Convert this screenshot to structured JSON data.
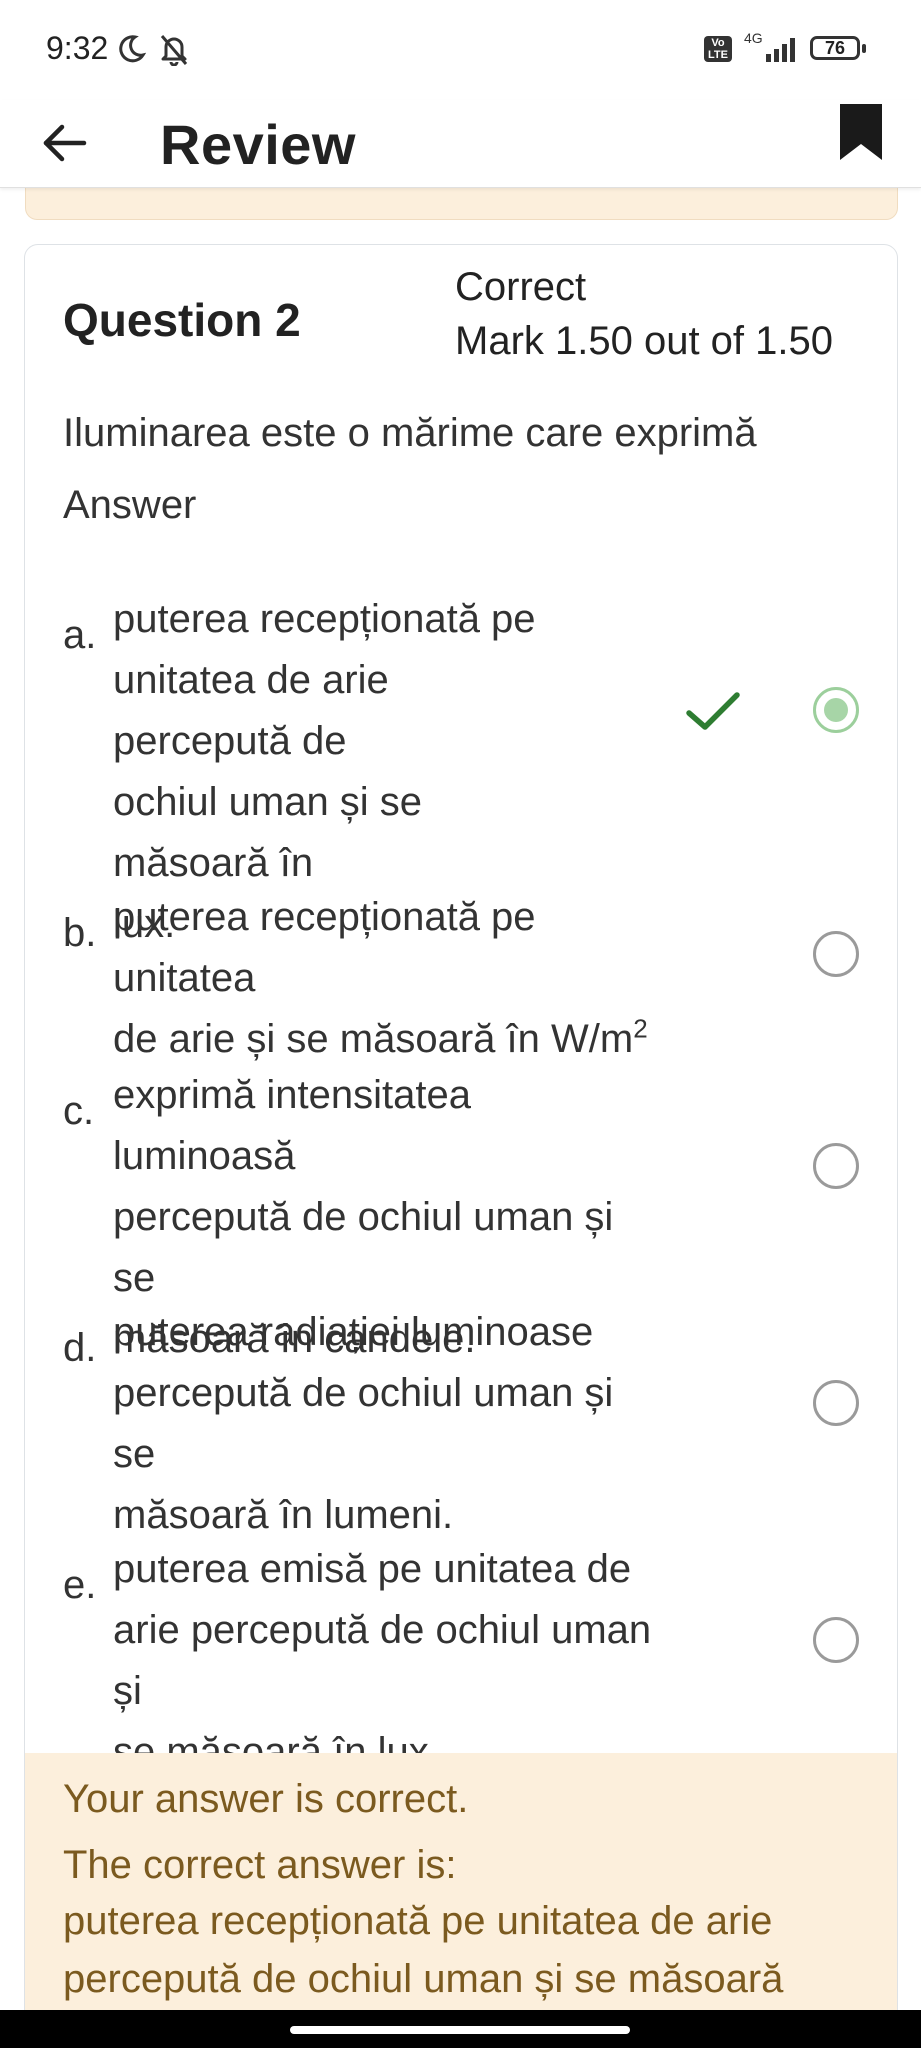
{
  "status_bar": {
    "time": "9:32",
    "volte_label": "Vo LTE",
    "network": "4G",
    "battery": "76"
  },
  "app_bar": {
    "title": "Review",
    "back_icon": "arrow-left-icon",
    "bookmark_icon": "bookmark-icon"
  },
  "question": {
    "number": "Question 2",
    "state": "Correct",
    "mark": "Mark 1.50 out of 1.50",
    "text": "Iluminarea este o mărime care exprimă",
    "answer_label": "Answer",
    "options": [
      {
        "letter": "a.",
        "lines": [
          "puterea recepționată pe",
          "unitatea de arie percepută de",
          "ochiul uman și se măsoară în",
          "lux."
        ],
        "selected": true,
        "correct": true
      },
      {
        "letter": "b.",
        "lines": [
          "puterea recepționată pe unitatea",
          "de arie și se măsoară în W/m",
          "2"
        ],
        "selected": false
      },
      {
        "letter": "c.",
        "lines": [
          "exprimă intensitatea luminoasă",
          "percepută de ochiul uman și se",
          "măsoară în candele."
        ],
        "selected": false
      },
      {
        "letter": "d.",
        "lines": [
          "puterea radiației luminoase",
          "percepută de ochiul uman și se",
          "măsoară în lumeni."
        ],
        "selected": false
      },
      {
        "letter": "e.",
        "lines": [
          "puterea emisă pe unitatea de",
          "arie percepută de ochiul uman și",
          "se măsoară în lux."
        ],
        "selected": false
      }
    ]
  },
  "feedback": {
    "result": "Your answer is correct.",
    "correct_intro": "The correct answer is:",
    "correct_line1": "puterea recepționată pe unitatea de arie",
    "correct_line2": "percepută de ochiul uman și se măsoară"
  },
  "colors": {
    "feedback_bg": "#fcefdc",
    "feedback_text": "#7b5a1f",
    "check_green": "#2e7d32",
    "radio_checked": "#a7d5a7"
  }
}
